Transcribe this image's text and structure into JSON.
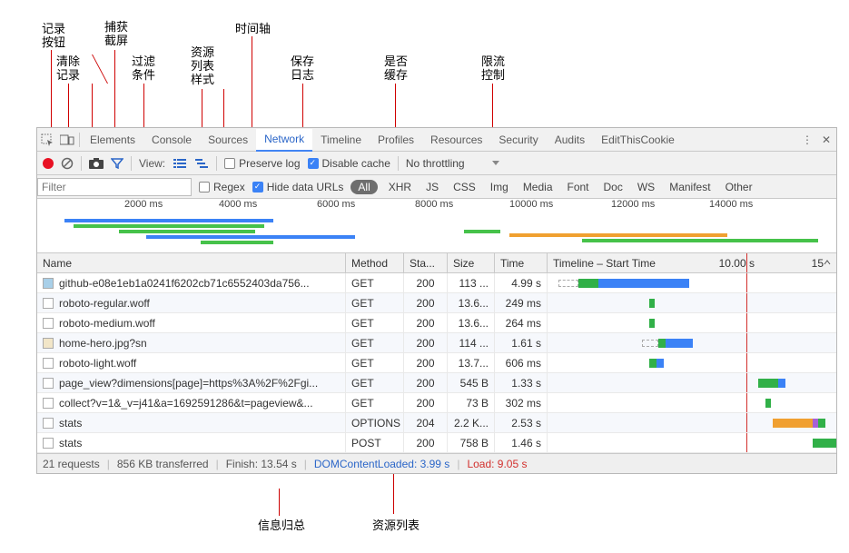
{
  "annotations_top": {
    "record_button": "记录\n按钮",
    "clear_log": "清除\n记录",
    "capture_screenshot": "捕获\n截屏",
    "filter_condition": "过滤\n条件",
    "resource_list_style": "资源\n列表\n样式",
    "timeline": "时间轴",
    "preserve_log_label": "保存\n日志",
    "cache_label": "是否\n缓存",
    "throttle_label": "限流\n控制"
  },
  "annotations_bottom": {
    "info_summary": "信息归总",
    "resource_list": "资源列表"
  },
  "tabs": [
    "Elements",
    "Console",
    "Sources",
    "Network",
    "Timeline",
    "Profiles",
    "Resources",
    "Security",
    "Audits",
    "EditThisCookie"
  ],
  "active_tab": "Network",
  "toolbar": {
    "view_label": "View:",
    "preserve_log": "Preserve log",
    "disable_cache": "Disable cache",
    "throttling": "No throttling"
  },
  "filterbar": {
    "filter_placeholder": "Filter",
    "regex": "Regex",
    "hide_data_urls": "Hide data URLs",
    "types": [
      "All",
      "XHR",
      "JS",
      "CSS",
      "Img",
      "Media",
      "Font",
      "Doc",
      "WS",
      "Manifest",
      "Other"
    ],
    "active_type": "All"
  },
  "overview_ticks": [
    "2000 ms",
    "4000 ms",
    "6000 ms",
    "8000 ms",
    "10000 ms",
    "12000 ms",
    "14000 ms"
  ],
  "columns": {
    "name": "Name",
    "method": "Method",
    "status": "Sta...",
    "size": "Size",
    "time": "Time",
    "timeline": "Timeline – Start Time",
    "tl_mid": "10.00 s",
    "tl_right": "15"
  },
  "rows": [
    {
      "icon": "css",
      "name": "github-e08e1eb1a0241f6202cb71c6552403da756...",
      "method": "GET",
      "status": "200",
      "size": "113 ...",
      "time": "4.99 s"
    },
    {
      "icon": "blank",
      "name": "roboto-regular.woff",
      "method": "GET",
      "status": "200",
      "size": "13.6...",
      "time": "249 ms"
    },
    {
      "icon": "blank",
      "name": "roboto-medium.woff",
      "method": "GET",
      "status": "200",
      "size": "13.6...",
      "time": "264 ms"
    },
    {
      "icon": "img",
      "name": "home-hero.jpg?sn",
      "method": "GET",
      "status": "200",
      "size": "114 ...",
      "time": "1.61 s"
    },
    {
      "icon": "blank",
      "name": "roboto-light.woff",
      "method": "GET",
      "status": "200",
      "size": "13.7...",
      "time": "606 ms"
    },
    {
      "icon": "blank",
      "name": "page_view?dimensions[page]=https%3A%2F%2Fgi...",
      "method": "GET",
      "status": "200",
      "size": "545 B",
      "time": "1.33 s"
    },
    {
      "icon": "blank",
      "name": "collect?v=1&_v=j41&a=1692591286&t=pageview&...",
      "method": "GET",
      "status": "200",
      "size": "73 B",
      "time": "302 ms"
    },
    {
      "icon": "blank",
      "name": "stats",
      "method": "OPTIONS",
      "status": "204",
      "size": "2.2 K...",
      "time": "2.53 s"
    },
    {
      "icon": "blank",
      "name": "stats",
      "method": "POST",
      "status": "200",
      "size": "758 B",
      "time": "1.46 s"
    }
  ],
  "summary": {
    "requests": "21 requests",
    "transferred": "856 KB transferred",
    "finish": "Finish: 13.54 s",
    "dcl": "DOMContentLoaded: 3.99 s",
    "load": "Load: 9.05 s"
  }
}
